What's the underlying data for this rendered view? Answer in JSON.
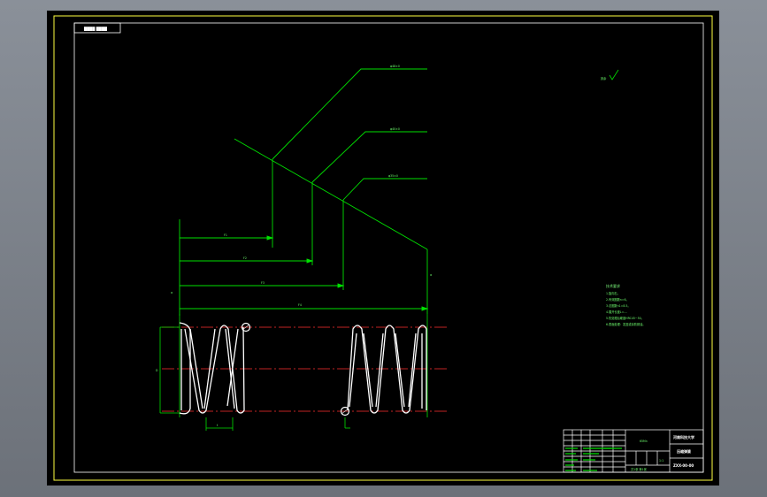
{
  "drawing": {
    "tag_text": "████ ████",
    "leader_labels": [
      "φ48±0",
      "φ40±0",
      "φ35±0"
    ],
    "dim_labels": [
      "F1",
      "F2",
      "F3",
      "F4"
    ],
    "diameter_label": "D",
    "pitch_label": "t",
    "angle_label": "α",
    "roughness_text": "其余",
    "notes_title": "技术要求",
    "notes": [
      "1.旋向右。",
      "2.有效圈数n=6。",
      "3.总圈数n1=8.5。",
      "4.展开长度L=....",
      "5.热处理后硬度HRC45~50。",
      "6.表面处理：发蓝或涂防锈油。"
    ]
  },
  "title_block": {
    "school": "河南科技大学",
    "part_name": "压缩弹簧",
    "drawing_no": "ZXX-00-00",
    "material": "65Mn",
    "scale": "1:1",
    "sheet": "共1张 第1张"
  },
  "colors": {
    "background": "#000000",
    "frame": "#ffff00",
    "line": "#00ff00",
    "spring": "#ffffff",
    "centerline": "#ff3030"
  }
}
